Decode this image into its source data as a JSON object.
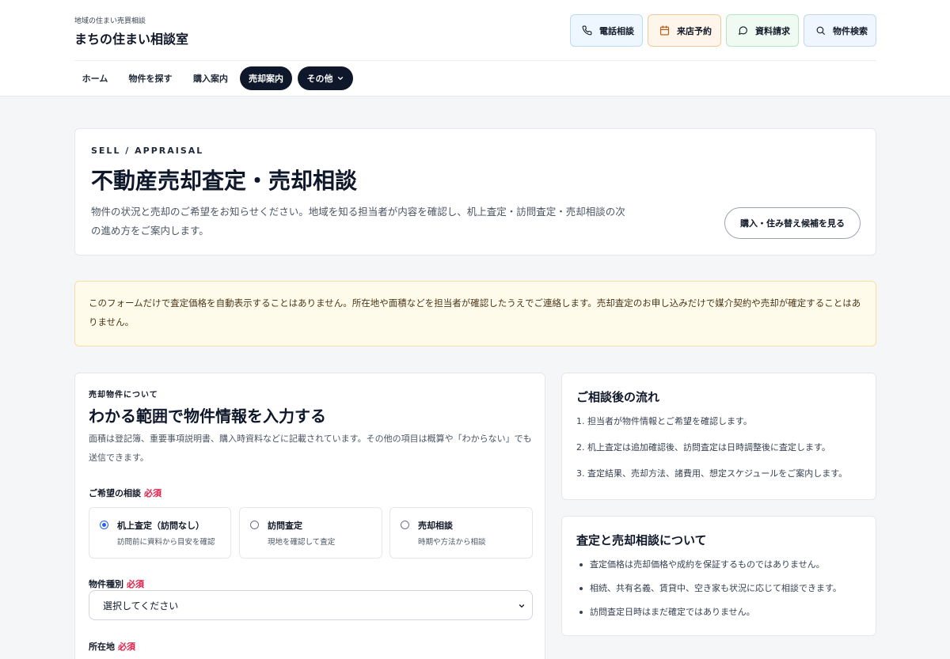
{
  "header": {
    "brand_sub": "地域の住まい売買相談",
    "brand_name": "まちの住まい相談室",
    "quick_links": [
      {
        "label": "電話相談",
        "icon": "phone-icon"
      },
      {
        "label": "来店予約",
        "icon": "calendar-icon"
      },
      {
        "label": "資料請求",
        "icon": "chat-icon"
      },
      {
        "label": "物件検索",
        "icon": "search-icon"
      }
    ]
  },
  "nav": {
    "items": [
      "ホーム",
      "物件を探す",
      "購入案内",
      "売却案内"
    ],
    "other_label": "その他",
    "active": "売却案内"
  },
  "hero": {
    "eyebrow": "SELL / APPRAISAL",
    "title": "不動産売却査定・売却相談",
    "description": "物件の状況と売却のご希望をお知らせください。地域を知る担当者が内容を確認し、机上査定・訪問査定・売却相談の次の進め方をご案内します。",
    "button_label": "購入・住み替え候補を見る"
  },
  "notice": {
    "text": "このフォームだけで査定価格を自動表示することはありません。所在地や面積などを担当者が確認したうえでご連絡します。売却査定のお申し込みだけで媒介契約や売却が確定することはありません。"
  },
  "form": {
    "eyebrow": "売却物件について",
    "title": "わかる範囲で物件情報を入力する",
    "description": "面積は登記簿、重要事項説明書、購入時資料などに記載されています。その他の項目は概算や「わからない」でも送信できます。",
    "required_label": "必須",
    "consult_label": "ご希望の相談",
    "options": [
      {
        "title": "机上査定（訪問なし）",
        "sub": "訪問前に資料から目安を確認",
        "checked": true
      },
      {
        "title": "訪問査定",
        "sub": "現地を確認して査定",
        "checked": false
      },
      {
        "title": "売却相談",
        "sub": "時期や方法から相談",
        "checked": false
      }
    ],
    "type_label": "物件種別",
    "type_value": "選択してください",
    "location_label": "所在地"
  },
  "flow": {
    "title": "ご相談後の流れ",
    "steps": [
      "1. 担当者が物件情報とご希望を確認します。",
      "2. 机上査定は追加確認後、訪問査定は日時調整後に査定します。",
      "3. 査定結果、売却方法、諸費用、想定スケジュールをご案内します。"
    ]
  },
  "about": {
    "title": "査定と売却相談について",
    "items": [
      "査定価格は売却価格や成約を保証するものではありません。",
      "相続、共有名義、賃貸中、空き家も状況に応じて相談できます。",
      "訪問査定日時はまだ確定ではありません。"
    ]
  },
  "colors": {
    "nav_active": "#0f172a",
    "required": "#e11d48",
    "notice_bg": "#fffbeb",
    "radio_accent": "#2563eb"
  }
}
